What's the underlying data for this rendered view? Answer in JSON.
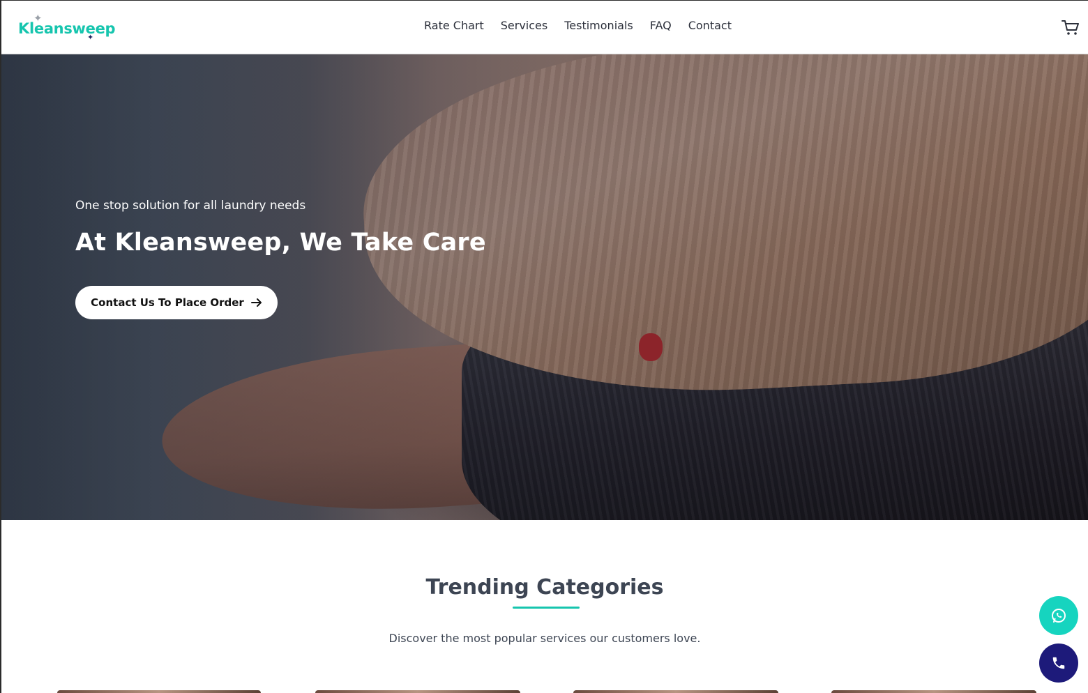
{
  "brand": {
    "name": "Kleansweep",
    "primary_color": "#16c5ae",
    "accent_color": "#1d1a7a"
  },
  "nav": {
    "items": [
      {
        "label": "Rate Chart"
      },
      {
        "label": "Services"
      },
      {
        "label": "Testimonials"
      },
      {
        "label": "FAQ"
      },
      {
        "label": "Contact"
      }
    ],
    "cart_icon": "cart-icon"
  },
  "hero": {
    "subtitle": "One stop solution for all laundry needs",
    "title": "At Kleansweep, We Take Care",
    "cta_label": "Contact Us To Place Order",
    "cta_icon": "arrow-right-icon"
  },
  "trending": {
    "title": "Trending Categories",
    "subtitle": "Discover the most popular services our customers love."
  },
  "floating_actions": {
    "whatsapp_icon": "whatsapp-icon",
    "phone_icon": "phone-icon"
  }
}
